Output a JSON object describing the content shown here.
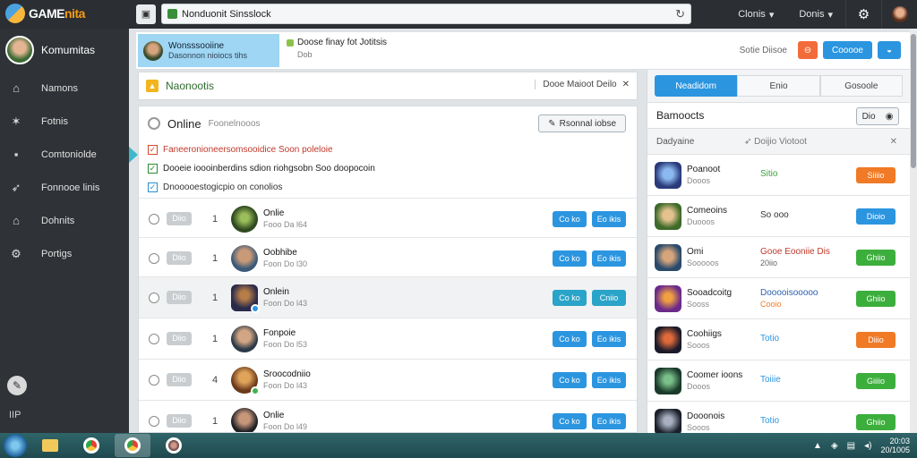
{
  "topbar": {
    "logo_main": "GAME",
    "logo_accent": "nita",
    "search_value": "Nonduonit Sinsslock",
    "menu1": "Clonis",
    "menu2": "Donis"
  },
  "sidebar": {
    "profile_name": "Komumitas",
    "items": [
      {
        "label": "Namons"
      },
      {
        "label": "Fotnis"
      },
      {
        "label": "Comtoniolde"
      },
      {
        "label": "Fonnooe linis"
      },
      {
        "label": "Dohnits"
      },
      {
        "label": "Portigs"
      }
    ],
    "bottom_label": "IIP"
  },
  "header": {
    "notif_title": "Wonsssooiine",
    "notif_sub": "Dasonnon nioiocs tihs",
    "info_line1": "Doose finay fot Jotitsis",
    "info_line2": "Dob",
    "right_label": "Sotie Diisoe",
    "blue_button": "Cooooe"
  },
  "main": {
    "title": "Naonootis",
    "title_right": "Dooe Maioot Deilo",
    "online_title": "Online",
    "online_sub": "Foonelnooos",
    "remind_button": "Rsonnal iobse",
    "checks": [
      {
        "text": "Faneeronioneersomsooidice Soon poleloie"
      },
      {
        "text": "Dooeie ioooinberdins sdion riohgsobn Soo doopocoin"
      },
      {
        "text": "Dnooooestogicpio on conolios"
      }
    ],
    "rows": [
      {
        "tag": "Diio",
        "num": "1",
        "name": "Onlie",
        "sub": "Fooo Da l64",
        "btn1": "Co ko",
        "btn2": "Eo ikis"
      },
      {
        "tag": "Diio",
        "num": "1",
        "name": "Oobhibe",
        "sub": "Foon Do l30",
        "btn1": "Co ko",
        "btn2": "Eo ikis"
      },
      {
        "tag": "Diio",
        "num": "1",
        "name": "Onlein",
        "sub": "Foon Do l43",
        "btn1": "Co ko",
        "btn2": "Cniio"
      },
      {
        "tag": "Diio",
        "num": "1",
        "name": "Fonpoie",
        "sub": "Foon Do l53",
        "btn1": "Co ko",
        "btn2": "Eo ikis"
      },
      {
        "tag": "Diio",
        "num": "4",
        "name": "Sroocodniio",
        "sub": "Foon Do l43",
        "btn1": "Co ko",
        "btn2": "Eo ikis"
      },
      {
        "tag": "Diio",
        "num": "1",
        "name": "Onlie",
        "sub": "Foon Do l49",
        "btn1": "Co ko",
        "btn2": "Eo ikis"
      }
    ]
  },
  "right": {
    "tabs": [
      "Neadidom",
      "Enio",
      "Gosoole"
    ],
    "title": "Bamoocts",
    "select_value": "Dio",
    "sub1": "Dadyaine",
    "sub2": "Doijio Viotoot",
    "rows": [
      {
        "name": "Poanoot",
        "sub": "Dooos",
        "status": "Sitio",
        "status2": "",
        "btn": "Siiiio"
      },
      {
        "name": "Comeoins",
        "sub": "Duooos",
        "status": "So ooo",
        "status2": "",
        "btn": "Dioio"
      },
      {
        "name": "Omi",
        "sub": "Sooooos",
        "status": "Gooe Eooniie Dis",
        "status2": "20iio",
        "btn": "Ghiio"
      },
      {
        "name": "Sooadcoitg",
        "sub": "Sooss",
        "status": "Dooooisooooo",
        "status2": "Cooio",
        "btn": "Ghiio"
      },
      {
        "name": "Coohiigs",
        "sub": "Sooos",
        "status": "Totio",
        "status2": "",
        "btn": "Diiio"
      },
      {
        "name": "Coomer ioons",
        "sub": "Dooos",
        "status": "Toiiie",
        "status2": "",
        "btn": "Giiiio"
      },
      {
        "name": "Dooonois",
        "sub": "Sooos",
        "status": "Totio",
        "status2": "",
        "btn": "Ghiio"
      }
    ]
  },
  "taskbar": {
    "clock_time": "20:03",
    "clock_date": "20/1005"
  }
}
